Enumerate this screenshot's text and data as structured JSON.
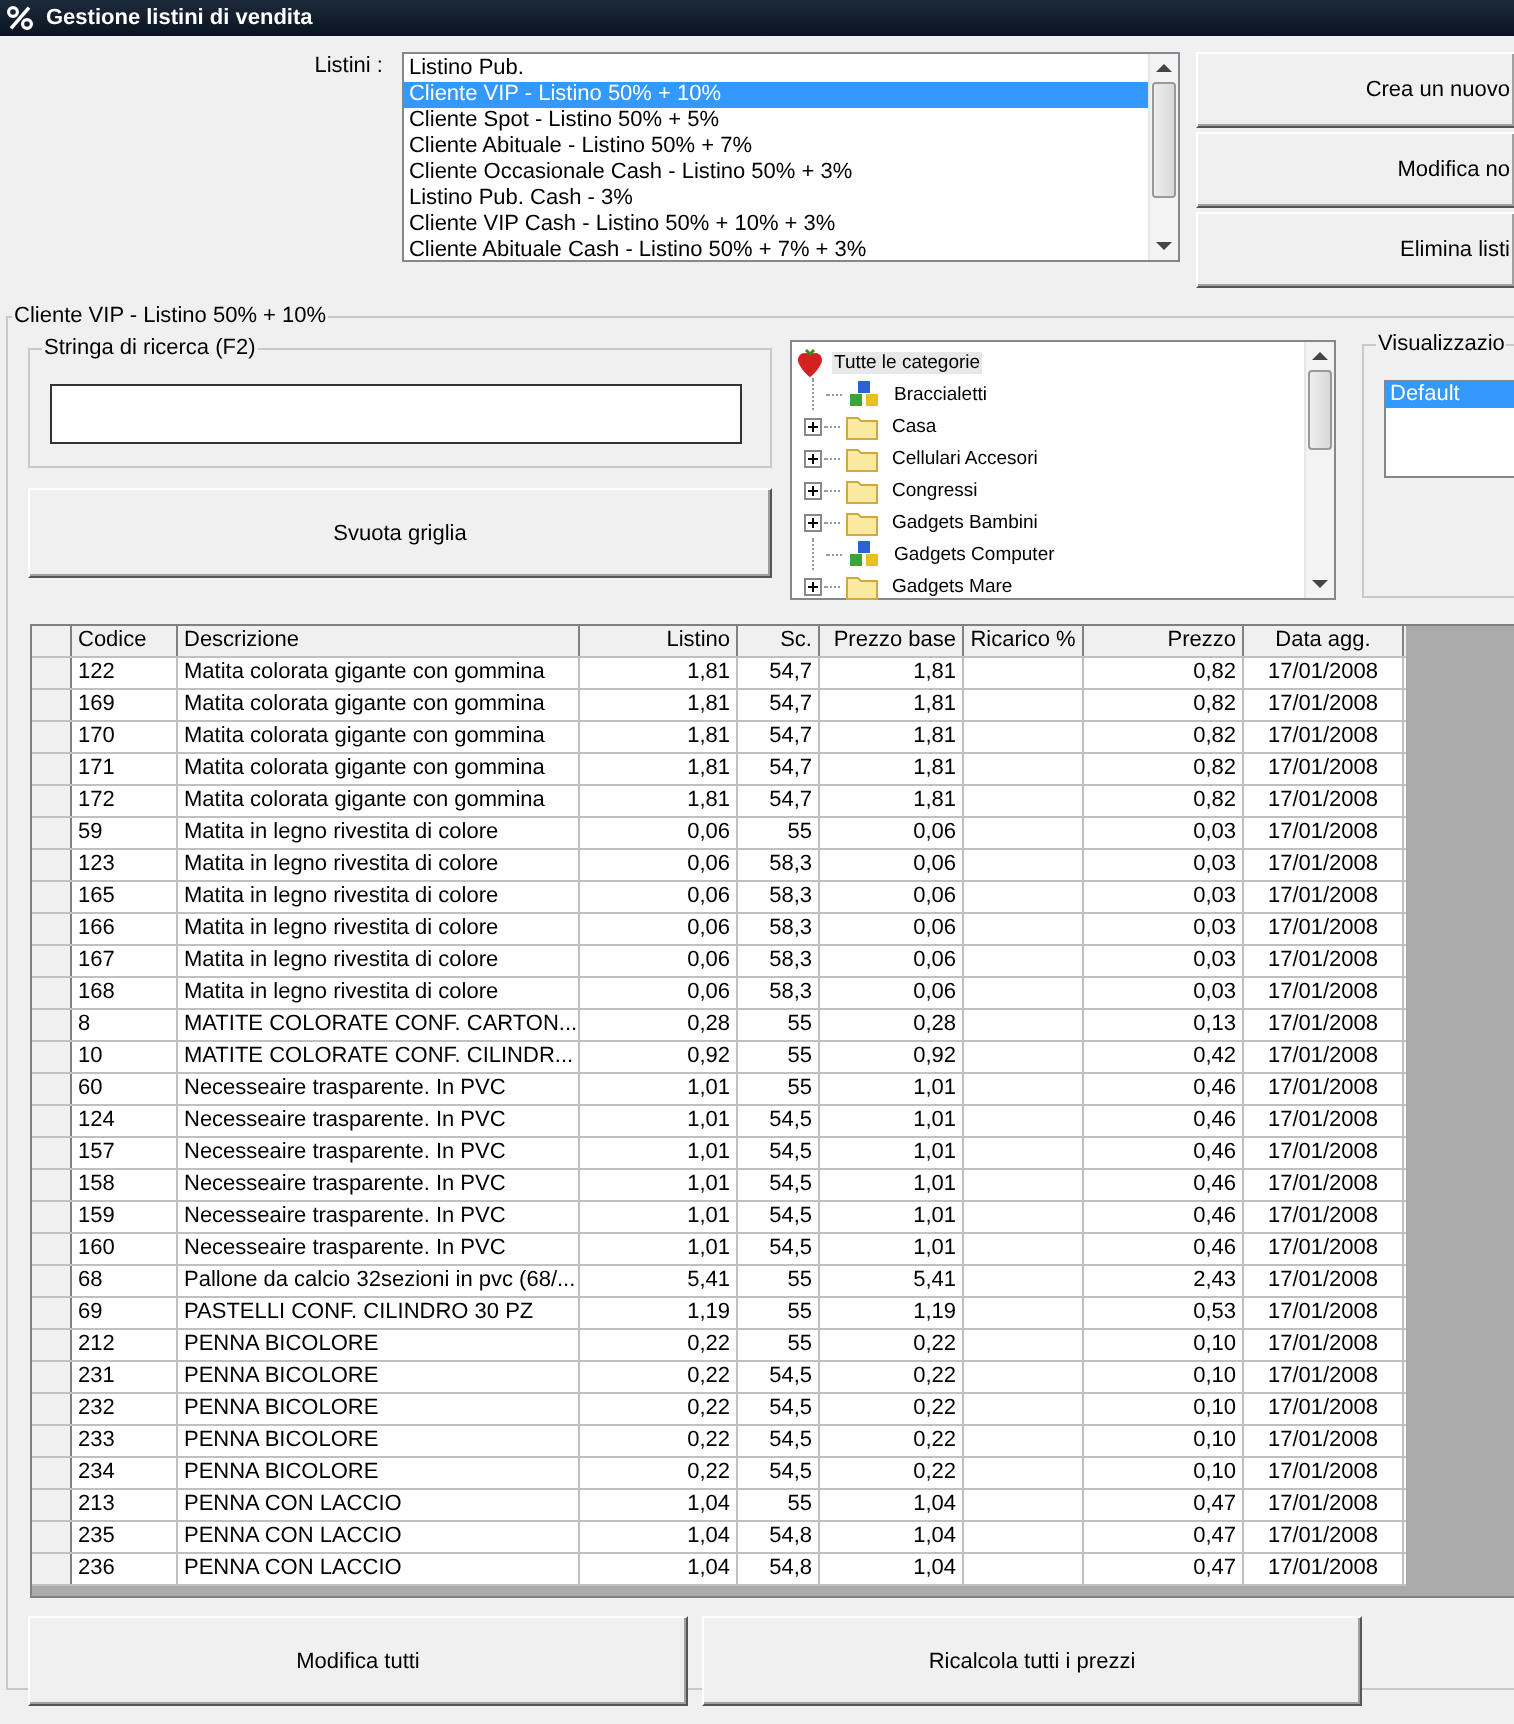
{
  "window": {
    "title": "Gestione listini di vendita"
  },
  "listini": {
    "label": "Listini :",
    "items": [
      {
        "label": "Listino Pub.",
        "selected": false
      },
      {
        "label": "Cliente VIP - Listino 50% + 10%",
        "selected": true
      },
      {
        "label": "Cliente Spot - Listino 50% + 5%",
        "selected": false
      },
      {
        "label": "Cliente Abituale - Listino 50% + 7%",
        "selected": false
      },
      {
        "label": "Cliente Occasionale Cash - Listino 50% + 3%",
        "selected": false
      },
      {
        "label": "Listino Pub. Cash - 3%",
        "selected": false
      },
      {
        "label": "Cliente VIP Cash - Listino 50% + 10% + 3%",
        "selected": false
      },
      {
        "label": "Cliente Abituale Cash - Listino 50% + 7% + 3%",
        "selected": false
      }
    ]
  },
  "side_buttons": [
    "Crea un nuovo",
    "Modifica no",
    "Elimina listi"
  ],
  "group": {
    "title": "Cliente VIP - Listino 50% + 10%"
  },
  "search": {
    "title": "Stringa di ricerca (F2)"
  },
  "clear_button": "Svuota griglia",
  "tree": {
    "label": "Tutte le categorie",
    "selected": true,
    "children": [
      {
        "label": "Braccialetti",
        "kind": "leaf",
        "selected": false
      },
      {
        "label": "Casa",
        "kind": "folder",
        "selected": false
      },
      {
        "label": "Cellulari Accesori",
        "kind": "folder",
        "selected": false
      },
      {
        "label": "Congressi",
        "kind": "folder",
        "selected": false
      },
      {
        "label": "Gadgets Bambini",
        "kind": "folder",
        "selected": false
      },
      {
        "label": "Gadgets Computer",
        "kind": "leaf",
        "selected": false
      },
      {
        "label": "Gadgets Mare",
        "kind": "folder",
        "selected": false
      }
    ]
  },
  "view": {
    "title": "Visualizzazio",
    "items": [
      {
        "label": "Default",
        "selected": true
      }
    ]
  },
  "table": {
    "columns": [
      "Codice",
      "Descrizione",
      "Listino",
      "Sc.",
      "Prezzo base",
      "Ricarico %",
      "Prezzo",
      "Data agg."
    ],
    "rows": [
      {
        "codice": "122",
        "descrizione": "Matita colorata gigante con gommina",
        "listino": "1,81",
        "sc": "54,7",
        "prezzo_base": "1,81",
        "prezzo": "0,82",
        "data_agg": "17/01/2008"
      },
      {
        "codice": "169",
        "descrizione": "Matita colorata gigante con gommina",
        "listino": "1,81",
        "sc": "54,7",
        "prezzo_base": "1,81",
        "prezzo": "0,82",
        "data_agg": "17/01/2008"
      },
      {
        "codice": "170",
        "descrizione": "Matita colorata gigante con gommina",
        "listino": "1,81",
        "sc": "54,7",
        "prezzo_base": "1,81",
        "prezzo": "0,82",
        "data_agg": "17/01/2008"
      },
      {
        "codice": "171",
        "descrizione": "Matita colorata gigante con gommina",
        "listino": "1,81",
        "sc": "54,7",
        "prezzo_base": "1,81",
        "prezzo": "0,82",
        "data_agg": "17/01/2008"
      },
      {
        "codice": "172",
        "descrizione": "Matita colorata gigante con gommina",
        "listino": "1,81",
        "sc": "54,7",
        "prezzo_base": "1,81",
        "prezzo": "0,82",
        "data_agg": "17/01/2008"
      },
      {
        "codice": "59",
        "descrizione": "Matita in legno rivestita di colore",
        "listino": "0,06",
        "sc": "55",
        "prezzo_base": "0,06",
        "prezzo": "0,03",
        "data_agg": "17/01/2008"
      },
      {
        "codice": "123",
        "descrizione": "Matita in legno rivestita di colore",
        "listino": "0,06",
        "sc": "58,3",
        "prezzo_base": "0,06",
        "prezzo": "0,03",
        "data_agg": "17/01/2008"
      },
      {
        "codice": "165",
        "descrizione": "Matita in legno rivestita di colore",
        "listino": "0,06",
        "sc": "58,3",
        "prezzo_base": "0,06",
        "prezzo": "0,03",
        "data_agg": "17/01/2008"
      },
      {
        "codice": "166",
        "descrizione": "Matita in legno rivestita di colore",
        "listino": "0,06",
        "sc": "58,3",
        "prezzo_base": "0,06",
        "prezzo": "0,03",
        "data_agg": "17/01/2008"
      },
      {
        "codice": "167",
        "descrizione": "Matita in legno rivestita di colore",
        "listino": "0,06",
        "sc": "58,3",
        "prezzo_base": "0,06",
        "prezzo": "0,03",
        "data_agg": "17/01/2008"
      },
      {
        "codice": "168",
        "descrizione": "Matita in legno rivestita di colore",
        "listino": "0,06",
        "sc": "58,3",
        "prezzo_base": "0,06",
        "prezzo": "0,03",
        "data_agg": "17/01/2008"
      },
      {
        "codice": "8",
        "descrizione": "MATITE COLORATE CONF. CARTON...",
        "listino": "0,28",
        "sc": "55",
        "prezzo_base": "0,28",
        "prezzo": "0,13",
        "data_agg": "17/01/2008"
      },
      {
        "codice": "10",
        "descrizione": "MATITE COLORATE CONF. CILINDR...",
        "listino": "0,92",
        "sc": "55",
        "prezzo_base": "0,92",
        "prezzo": "0,42",
        "data_agg": "17/01/2008"
      },
      {
        "codice": "60",
        "descrizione": "Necesseaire trasparente. In PVC",
        "listino": "1,01",
        "sc": "55",
        "prezzo_base": "1,01",
        "prezzo": "0,46",
        "data_agg": "17/01/2008"
      },
      {
        "codice": "124",
        "descrizione": "Necesseaire trasparente. In PVC",
        "listino": "1,01",
        "sc": "54,5",
        "prezzo_base": "1,01",
        "prezzo": "0,46",
        "data_agg": "17/01/2008"
      },
      {
        "codice": "157",
        "descrizione": "Necesseaire trasparente. In PVC",
        "listino": "1,01",
        "sc": "54,5",
        "prezzo_base": "1,01",
        "prezzo": "0,46",
        "data_agg": "17/01/2008"
      },
      {
        "codice": "158",
        "descrizione": "Necesseaire trasparente. In PVC",
        "listino": "1,01",
        "sc": "54,5",
        "prezzo_base": "1,01",
        "prezzo": "0,46",
        "data_agg": "17/01/2008"
      },
      {
        "codice": "159",
        "descrizione": "Necesseaire trasparente. In PVC",
        "listino": "1,01",
        "sc": "54,5",
        "prezzo_base": "1,01",
        "prezzo": "0,46",
        "data_agg": "17/01/2008"
      },
      {
        "codice": "160",
        "descrizione": "Necesseaire trasparente. In PVC",
        "listino": "1,01",
        "sc": "54,5",
        "prezzo_base": "1,01",
        "prezzo": "0,46",
        "data_agg": "17/01/2008"
      },
      {
        "codice": "68",
        "descrizione": "Pallone da calcio 32sezioni in pvc (68/...",
        "listino": "5,41",
        "sc": "55",
        "prezzo_base": "5,41",
        "prezzo": "2,43",
        "data_agg": "17/01/2008"
      },
      {
        "codice": "69",
        "descrizione": "PASTELLI CONF. CILINDRO 30 PZ",
        "listino": "1,19",
        "sc": "55",
        "prezzo_base": "1,19",
        "prezzo": "0,53",
        "data_agg": "17/01/2008"
      },
      {
        "codice": "212",
        "descrizione": "PENNA BICOLORE",
        "listino": "0,22",
        "sc": "55",
        "prezzo_base": "0,22",
        "prezzo": "0,10",
        "data_agg": "17/01/2008"
      },
      {
        "codice": "231",
        "descrizione": "PENNA BICOLORE",
        "listino": "0,22",
        "sc": "54,5",
        "prezzo_base": "0,22",
        "prezzo": "0,10",
        "data_agg": "17/01/2008"
      },
      {
        "codice": "232",
        "descrizione": "PENNA BICOLORE",
        "listino": "0,22",
        "sc": "54,5",
        "prezzo_base": "0,22",
        "prezzo": "0,10",
        "data_agg": "17/01/2008"
      },
      {
        "codice": "233",
        "descrizione": "PENNA BICOLORE",
        "listino": "0,22",
        "sc": "54,5",
        "prezzo_base": "0,22",
        "prezzo": "0,10",
        "data_agg": "17/01/2008"
      },
      {
        "codice": "234",
        "descrizione": "PENNA BICOLORE",
        "listino": "0,22",
        "sc": "54,5",
        "prezzo_base": "0,22",
        "prezzo": "0,10",
        "data_agg": "17/01/2008"
      },
      {
        "codice": "213",
        "descrizione": "PENNA CON LACCIO",
        "listino": "1,04",
        "sc": "55",
        "prezzo_base": "1,04",
        "prezzo": "0,47",
        "data_agg": "17/01/2008"
      },
      {
        "codice": "235",
        "descrizione": "PENNA CON LACCIO",
        "listino": "1,04",
        "sc": "54,8",
        "prezzo_base": "1,04",
        "prezzo": "0,47",
        "data_agg": "17/01/2008"
      },
      {
        "codice": "236",
        "descrizione": "PENNA CON LACCIO",
        "listino": "1,04",
        "sc": "54,8",
        "prezzo_base": "1,04",
        "prezzo": "0,47",
        "data_agg": "17/01/2008"
      }
    ]
  },
  "bottom_buttons": [
    "Modifica tutti",
    "Ricalcola tutti i prezzi"
  ]
}
